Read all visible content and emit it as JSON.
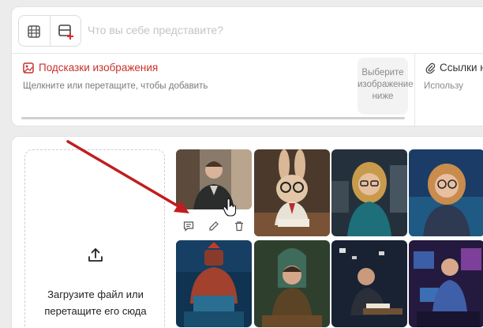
{
  "prompt": {
    "placeholder": "Что вы себе представите?"
  },
  "hints": {
    "title": "Подсказки изображения",
    "subtitle": "Щелкните или перетащите, чтобы добавить",
    "select_lines": [
      "Выберите",
      "изображение",
      "ниже"
    ]
  },
  "links": {
    "title": "Ссылки н",
    "subtitle": "Использу"
  },
  "upload": {
    "line1": "Загрузите файл или",
    "line2": "перетащите его сюда"
  },
  "colors": {
    "accent_red": "#c8322c",
    "arrow": "#c21d1d"
  },
  "icons": [
    "film-icon",
    "add-image-icon",
    "image-hint-icon",
    "paperclip-icon",
    "upload-icon",
    "comment-icon",
    "edit-icon",
    "trash-icon",
    "pointer-cursor-icon"
  ],
  "gallery": {
    "thumbnails": [
      "man-in-office",
      "rabbit-with-glasses-writing",
      "woman-with-glasses-studio",
      "woman-with-glasses-portrait",
      "warrior-robot-laptop",
      "man-in-library",
      "man-at-desk-night",
      "man-with-monitors"
    ]
  }
}
